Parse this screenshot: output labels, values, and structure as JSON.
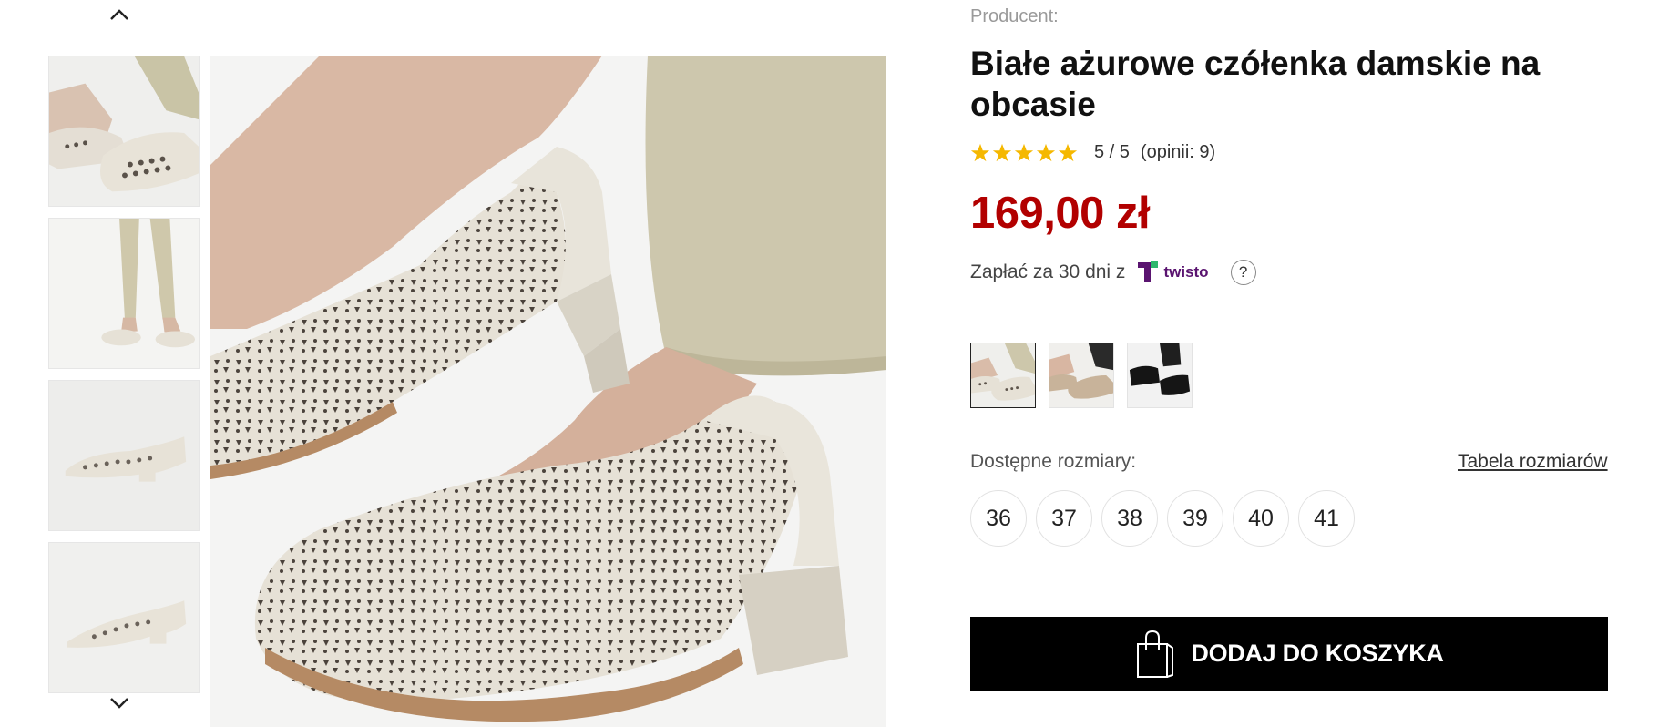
{
  "product": {
    "producer_label": "Producent:",
    "title": "Białe ażurowe czółenka damskie na obcasie",
    "rating": {
      "stars": 5,
      "score": "5 / 5",
      "reviews": "(opinii: 9)"
    },
    "price": "169,00 zł",
    "pay_later": {
      "text": "Zapłać za 30 dni z",
      "brand": "twisto",
      "help": "?"
    }
  },
  "gallery": {
    "thumbnails": [
      "shoe-pair-closeup",
      "full-legs-view",
      "side-profile",
      "angled-profile"
    ],
    "main_image": "white-openwork-pumps-closeup"
  },
  "variants": [
    {
      "name": "beige",
      "selected": true
    },
    {
      "name": "gold",
      "selected": false
    },
    {
      "name": "black",
      "selected": false
    }
  ],
  "sizes": {
    "label": "Dostępne rozmiary:",
    "table_link": "Tabela rozmiarów",
    "options": [
      "36",
      "37",
      "38",
      "39",
      "40",
      "41"
    ]
  },
  "cart": {
    "label": "DODAJ DO KOSZYKA"
  },
  "colors": {
    "price": "#b20000",
    "star": "#f5b800",
    "button": "#000000",
    "twisto": "#5a1470"
  }
}
